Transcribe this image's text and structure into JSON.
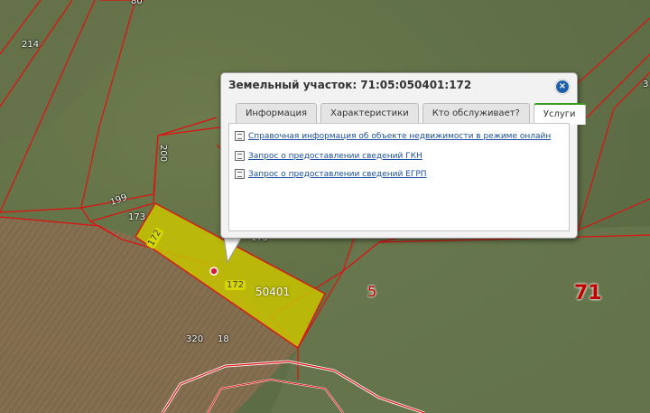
{
  "popup": {
    "title": "Земельный участок: 71:05:050401:172",
    "close": "×",
    "tabs": [
      {
        "label": "Информация",
        "active": false
      },
      {
        "label": "Характеристики",
        "active": false
      },
      {
        "label": "Кто обслуживает?",
        "active": false
      },
      {
        "label": "Услуги",
        "active": true
      }
    ],
    "links": [
      "Справочная информация об объекте недвижимости в режиме онлайн",
      "Запрос о предоставлении сведений ГКН",
      "Запрос о предоставлении сведений ЕГРП"
    ]
  },
  "map": {
    "labels": {
      "l80": "80",
      "l214": "214",
      "l200": "200",
      "l199": "199",
      "l173": "173",
      "l175": "175",
      "l172a": "172",
      "l172b": "172",
      "block": "50401",
      "l5": "5",
      "l71": "71",
      "l320": "320",
      "l18": "18",
      "lr": "3"
    },
    "colors": {
      "boundary": "#e01010",
      "selected_fill": "#c9c400",
      "marker": "#d21e3c",
      "accent_tab": "#3c9a1e"
    }
  }
}
